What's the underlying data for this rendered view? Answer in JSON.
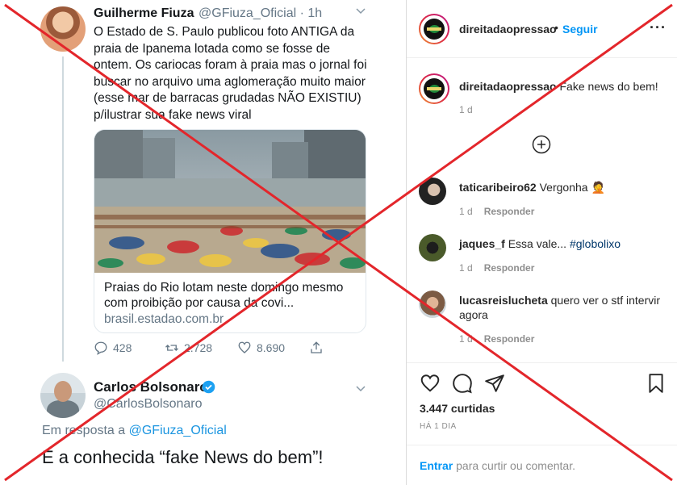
{
  "tweet": {
    "author_name": "Guilherme Fiuza",
    "author_handle": "@GFiuza_Oficial",
    "time": "· 1h",
    "text": "O Estado de S. Paulo publicou foto ANTIGA da praia de Ipanema lotada como se fosse de ontem. Os cariocas foram à praia mas o jornal foi buscar no arquivo uma aglomeração muito maior (esse mar de barracas grudadas NÃO EXISTIU) p/ilustrar sua fake news viral",
    "card": {
      "title": "Praias do Rio lotam neste domingo mesmo com proibição por causa da covi...",
      "domain": "brasil.estadao.com.br"
    },
    "replies": "428",
    "retweets": "2.728",
    "likes": "8.690"
  },
  "reply_tweet": {
    "author_name": "Carlos Bolsonaro",
    "author_handle": "@CarlosBolsonaro",
    "reply_prefix": "Em resposta a",
    "reply_target": "@GFiuza_Oficial",
    "text": "É a conhecida “fake News do bem”!"
  },
  "instagram": {
    "username": "direitadaopressao",
    "dot": "•",
    "follow_label": "Seguir",
    "more_label": "···",
    "caption_user": "direitadaopressao",
    "caption_text": "Fake news do bem!",
    "caption_time": "1 d",
    "comments": [
      {
        "user": "taticaribeiro62",
        "text": "Vergonha 🤦",
        "time": "1 d",
        "reply": "Responder"
      },
      {
        "user": "jaques_f",
        "text": "Essa vale... ",
        "hashtag": "#globolixo",
        "time": "1 d",
        "reply": "Responder"
      },
      {
        "user": "lucasreislucheta",
        "text": "quero ver o stf intervir agora",
        "time": "1 d",
        "reply": "Responder"
      }
    ],
    "likes": "3.447 curtidas",
    "posted": "HÁ 1 DIA",
    "login_link": "Entrar",
    "login_rest": " para curtir ou comentar."
  },
  "colors": {
    "cross": "#e3262b",
    "twitter_blue": "#1b95e0",
    "ig_blue": "#0095f6"
  }
}
